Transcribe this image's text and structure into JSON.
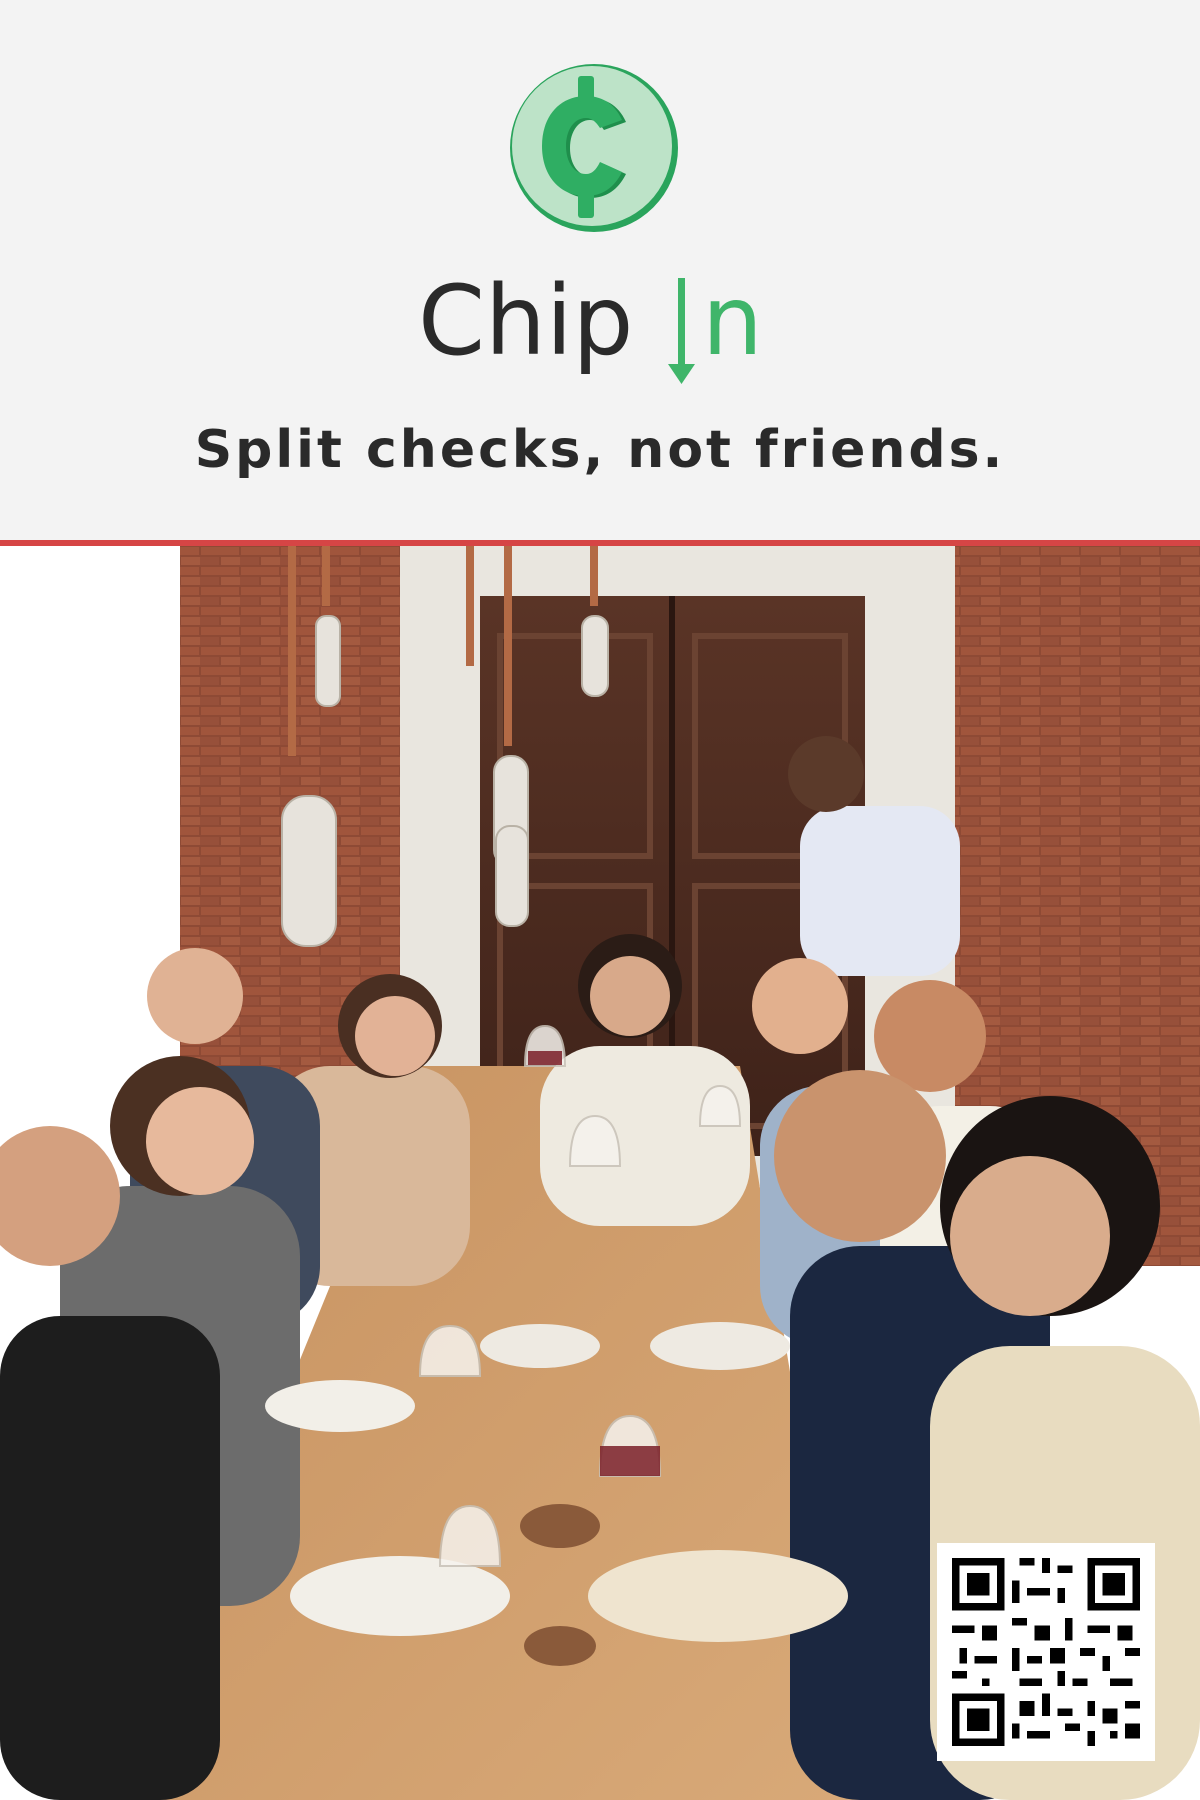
{
  "brand": {
    "name_prefix": "Chip",
    "name_suffix": "n",
    "logo_symbol": "¢",
    "logo_icon": "cent-coin-icon",
    "colors": {
      "accent_green": "#3fb56a",
      "logo_light": "#bde3c8",
      "logo_dark": "#2aa45c",
      "text_dark": "#2a2a2a",
      "divider_red": "#d64545"
    }
  },
  "tagline": "Split checks, not friends.",
  "photo": {
    "icon": "group-dinner-photo"
  },
  "qr": {
    "icon": "qr-code-icon"
  }
}
